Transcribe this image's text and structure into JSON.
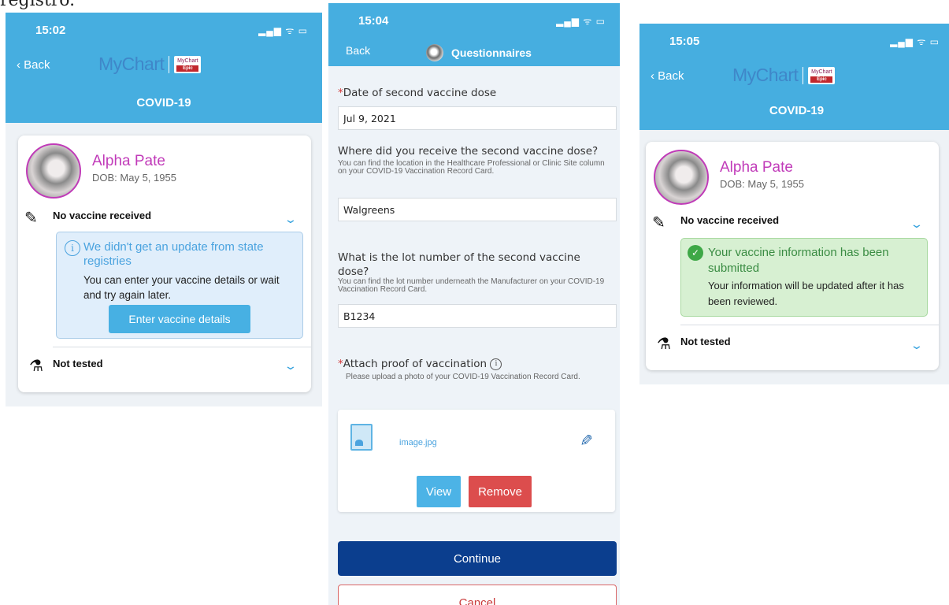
{
  "page_top_text": "registro.",
  "screen1": {
    "time": "15:02",
    "status_icons": "▂▄▆ ᯤ ▭",
    "back": "Back",
    "logo": "MyChart",
    "logo_badge": "MyChart",
    "logo_badge_sub": "Epic",
    "title": "COVID-19",
    "patient_name": "Alpha Pate",
    "dob": "DOB: May 5, 1955",
    "vaccine_row": "No vaccine received",
    "notice_head": "We didn't get an update from state registries",
    "notice_body": "You can enter your vaccine details or wait and try again later.",
    "enter_button": "Enter vaccine details",
    "test_row": "Not tested"
  },
  "screen2": {
    "time": "15:04",
    "status_icons": "▂▄▆ ᯤ ▭",
    "back": "Back",
    "title": "Questionnaires",
    "q1_label": "Date of second vaccine dose",
    "q1_value": "Jul 9, 2021",
    "q2_label": "Where did you receive the second vaccine dose?",
    "q2_help": "You can find the location in the Healthcare Professional or Clinic Site column on your COVID-19 Vaccination Record Card.",
    "q2_value": "Walgreens",
    "q3_label": "What is the lot number of the second vaccine dose?",
    "q3_help": "You can find the lot number underneath the Manufacturer on your COVID-19 Vaccination Record Card.",
    "q3_value": "B1234",
    "q4_label": "Attach proof of vaccination",
    "q4_help": "Please upload a photo of your COVID-19 Vaccination Record Card.",
    "file_name": "image.jpg",
    "view_button": "View",
    "remove_button": "Remove",
    "continue_button": "Continue",
    "cancel_button": "Cancel"
  },
  "screen3": {
    "time": "15:05",
    "status_icons": "▂▄▆ ᯤ ▭",
    "back": "Back",
    "logo": "MyChart",
    "logo_badge": "MyChart",
    "logo_badge_sub": "Epic",
    "title": "COVID-19",
    "patient_name": "Alpha Pate",
    "dob": "DOB: May 5, 1955",
    "vaccine_row": "No vaccine received",
    "notice_head": "Your vaccine information has been submitted",
    "notice_body": "Your information will be updated after it has been reviewed.",
    "test_row": "Not tested"
  },
  "colors": {
    "header": "#46aee0",
    "patient_name": "#c13bb9",
    "continue": "#0b3e8e",
    "remove": "#dc4d4d",
    "success": "#d7f0d2"
  }
}
